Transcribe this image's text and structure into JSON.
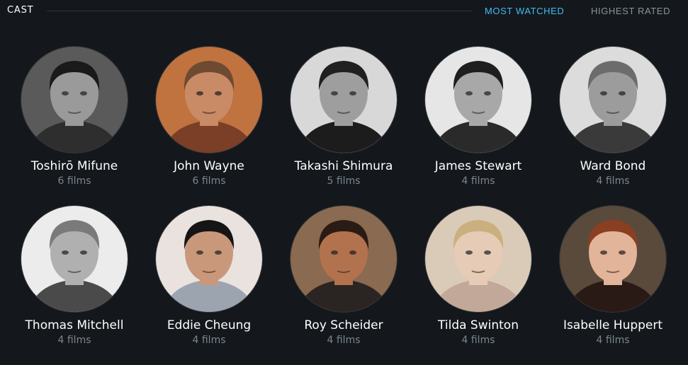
{
  "section": {
    "title": "CAST",
    "tabs": [
      {
        "label": "MOST WATCHED",
        "active": true
      },
      {
        "label": "HIGHEST RATED",
        "active": false
      }
    ]
  },
  "colors": {
    "accent": "#40bcf4",
    "background": "#14181c",
    "muted": "#7b8591"
  },
  "cast": [
    {
      "name": "Toshirō Mifune",
      "films": "6 films",
      "portrait": {
        "bg": "#5a5a5a",
        "skin": "#9a9a9a",
        "hair": "#1a1a1a",
        "cloth": "#2e2e2e"
      }
    },
    {
      "name": "John Wayne",
      "films": "6 films",
      "portrait": {
        "bg": "#c0723f",
        "skin": "#c98a66",
        "hair": "#6e4a30",
        "cloth": "#7a3f26"
      }
    },
    {
      "name": "Takashi Shimura",
      "films": "5 films",
      "portrait": {
        "bg": "#d8d8d8",
        "skin": "#9e9e9e",
        "hair": "#202020",
        "cloth": "#1c1c1c"
      }
    },
    {
      "name": "James Stewart",
      "films": "4 films",
      "portrait": {
        "bg": "#e6e6e6",
        "skin": "#a8a8a8",
        "hair": "#1e1e1e",
        "cloth": "#2a2a2a"
      }
    },
    {
      "name": "Ward Bond",
      "films": "4 films",
      "portrait": {
        "bg": "#dcdcdc",
        "skin": "#9c9c9c",
        "hair": "#6c6c6c",
        "cloth": "#3a3a3a"
      }
    },
    {
      "name": "Thomas Mitchell",
      "films": "4 films",
      "portrait": {
        "bg": "#ececec",
        "skin": "#b0b0b0",
        "hair": "#7a7a7a",
        "cloth": "#4a4a4a"
      }
    },
    {
      "name": "Eddie Cheung",
      "films": "4 films",
      "portrait": {
        "bg": "#e9e2de",
        "skin": "#c9987a",
        "hair": "#151515",
        "cloth": "#9ca4b0"
      }
    },
    {
      "name": "Roy Scheider",
      "films": "4 films",
      "portrait": {
        "bg": "#8a6a50",
        "skin": "#b3724e",
        "hair": "#2a1c14",
        "cloth": "#2a2422"
      }
    },
    {
      "name": "Tilda Swinton",
      "films": "4 films",
      "portrait": {
        "bg": "#d9cbb8",
        "skin": "#e6cbb6",
        "hair": "#c9b07e",
        "cloth": "#c2a898"
      }
    },
    {
      "name": "Isabelle Huppert",
      "films": "4 films",
      "portrait": {
        "bg": "#5a4a3c",
        "skin": "#e2b49a",
        "hair": "#8a3f22",
        "cloth": "#2a1a16"
      }
    }
  ]
}
